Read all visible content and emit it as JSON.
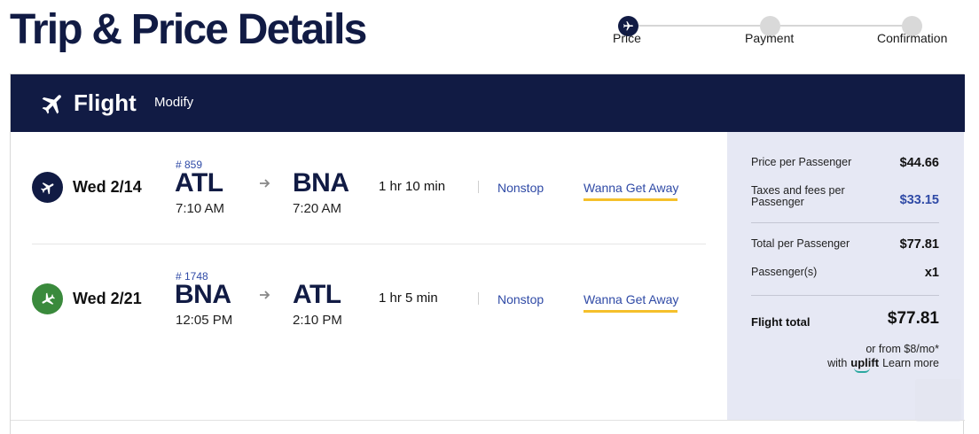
{
  "page": {
    "title": "Trip & Price Details"
  },
  "stepper": {
    "steps": [
      {
        "label": "Price",
        "state": "active",
        "icon": "airplane-icon"
      },
      {
        "label": "Payment",
        "state": "upcoming"
      },
      {
        "label": "Confirmation",
        "state": "upcoming"
      }
    ],
    "colors": {
      "active": "#111b44",
      "inactive": "#d9d9d9"
    }
  },
  "card": {
    "header": {
      "icon": "airplane-icon",
      "title": "Flight",
      "modify_label": "Modify",
      "background": "#111b44"
    }
  },
  "flights": [
    {
      "icon": "airplane-departure-icon",
      "icon_color": "#111b44",
      "date": "Wed 2/14",
      "flight_number": "# 859",
      "origin_code": "ATL",
      "depart_time": "7:10 AM",
      "destination_code": "BNA",
      "arrive_time": "7:20 AM",
      "duration": "1 hr 10 min",
      "stops": "Nonstop",
      "fare_class": "Wanna Get Away"
    },
    {
      "icon": "airplane-return-icon",
      "icon_color": "#3a8a3c",
      "date": "Wed 2/21",
      "flight_number": "# 1748",
      "origin_code": "BNA",
      "depart_time": "12:05 PM",
      "destination_code": "ATL",
      "arrive_time": "2:10 PM",
      "duration": "1 hr 5 min",
      "stops": "Nonstop",
      "fare_class": "Wanna Get Away"
    }
  ],
  "price_summary": {
    "price_per_passenger": {
      "label": "Price per Passenger",
      "value": "$44.66"
    },
    "taxes": {
      "label_line1": "Taxes and fees per",
      "label_line2": "Passenger",
      "value": "$33.15"
    },
    "total_per_passenger": {
      "label": "Total per Passenger",
      "value": "$77.81"
    },
    "passengers": {
      "label": "Passenger(s)",
      "value": "x1"
    },
    "flight_total": {
      "label": "Flight total",
      "value": "$77.81"
    },
    "uplift": {
      "line1": "or from $8/mo*",
      "with_text": "with",
      "logo_text": "uplift",
      "learn_more": "Learn more"
    },
    "panel_color": "#e6e8f4",
    "accent_blue": "#2f4aa6",
    "fare_underline_color": "#f5c02b"
  }
}
